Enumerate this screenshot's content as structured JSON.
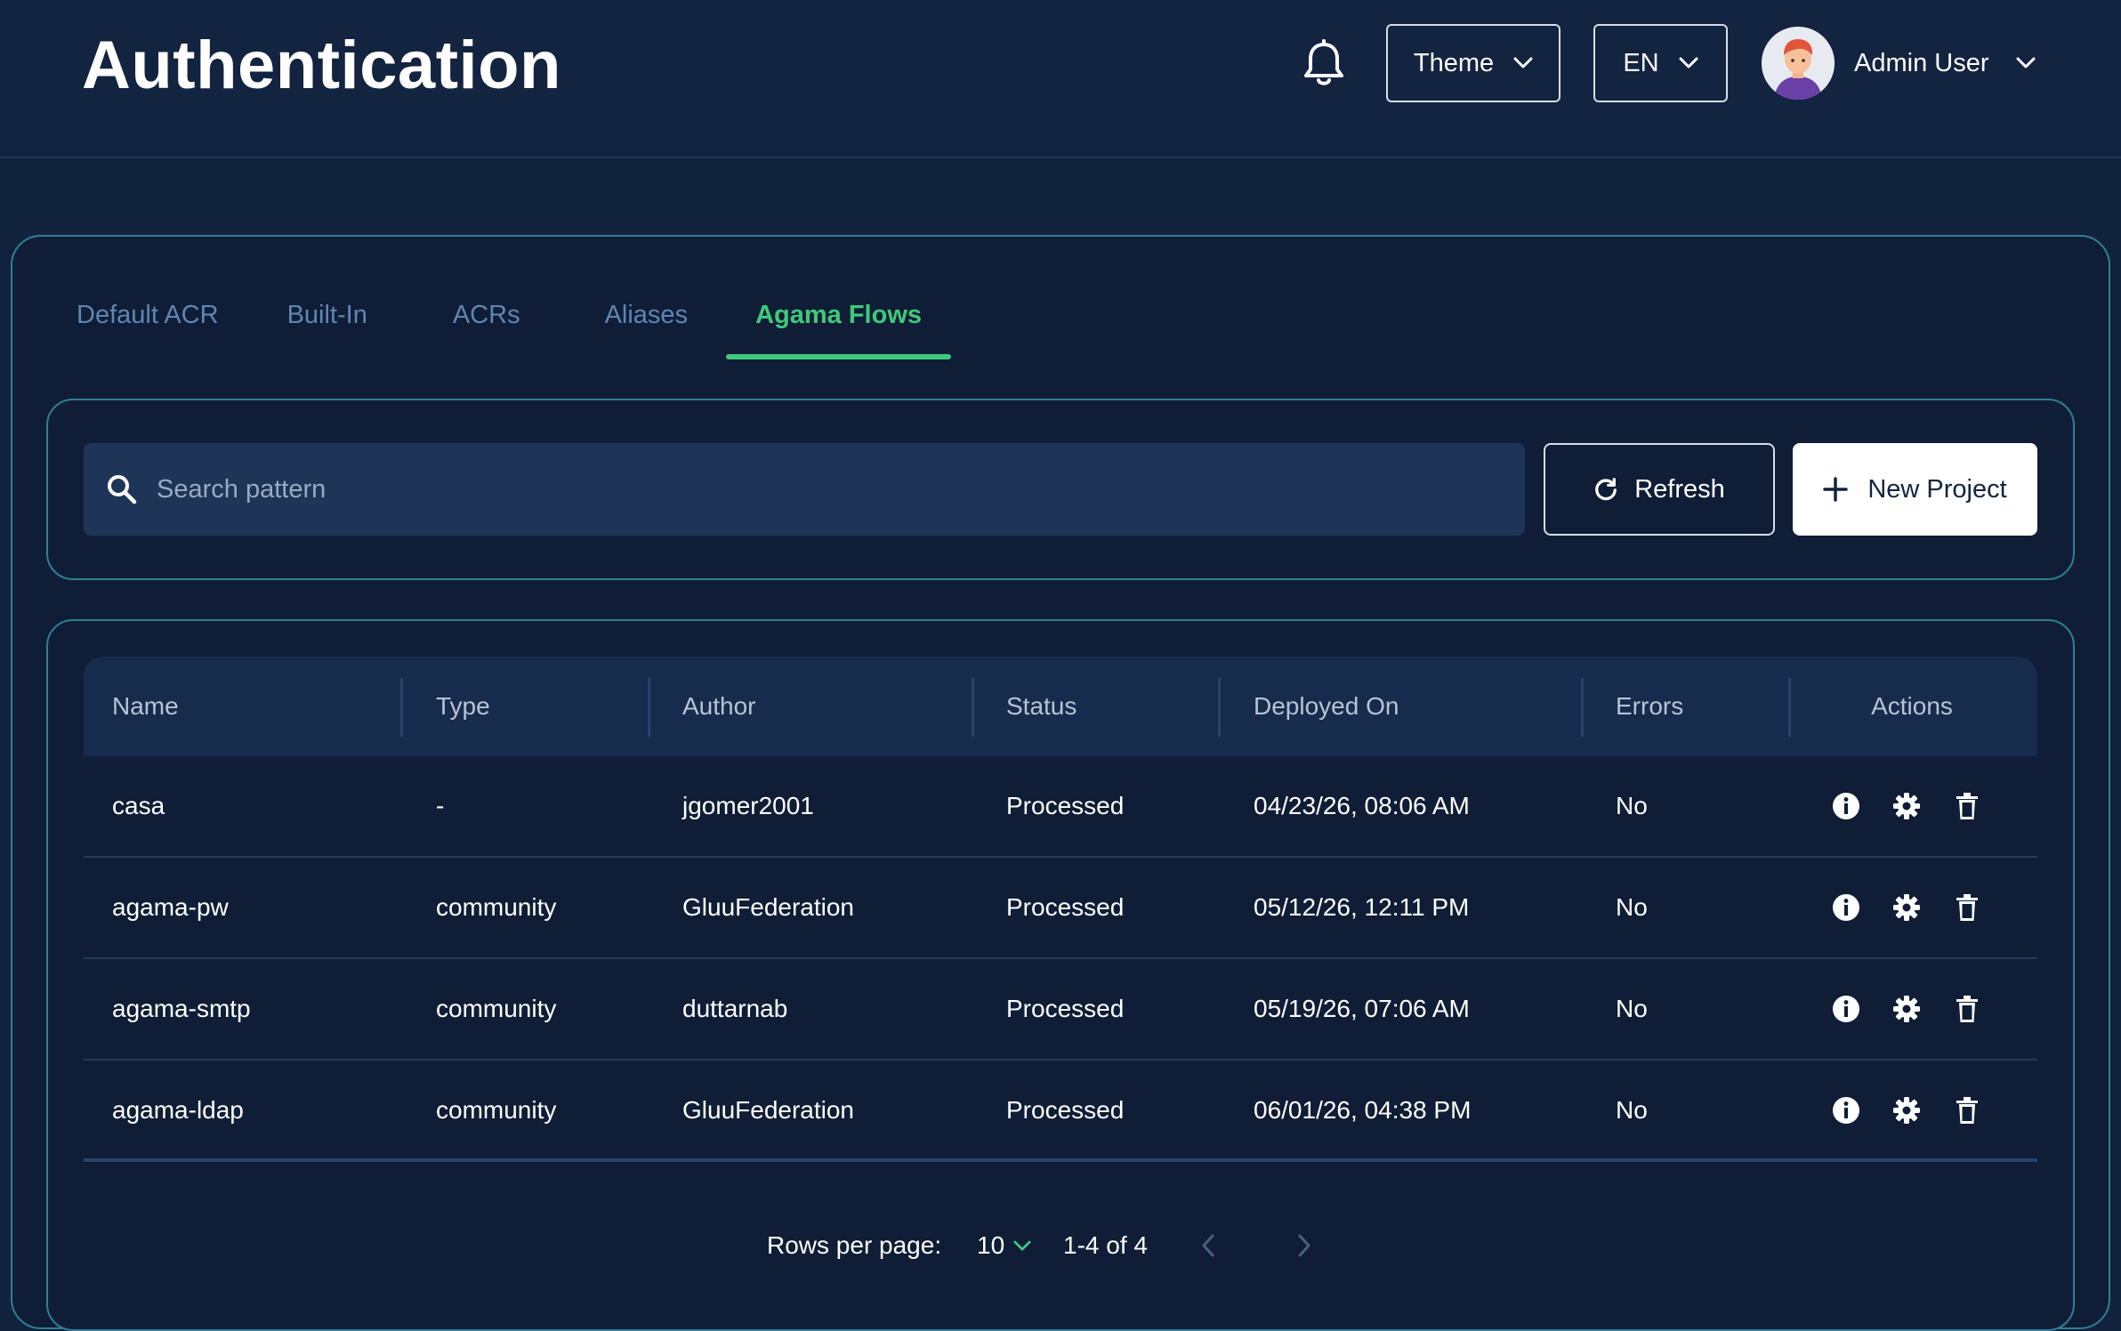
{
  "header": {
    "title": "Authentication",
    "theme_label": "Theme",
    "lang_label": "EN",
    "user_name": "Admin User"
  },
  "tabs": [
    {
      "label": "Default ACR",
      "active": false
    },
    {
      "label": "Built-In",
      "active": false
    },
    {
      "label": "ACRs",
      "active": false
    },
    {
      "label": "Aliases",
      "active": false
    },
    {
      "label": "Agama Flows",
      "active": true
    }
  ],
  "toolbar": {
    "search_placeholder": "Search pattern",
    "search_value": "",
    "refresh_label": "Refresh",
    "new_project_label": "New Project"
  },
  "table": {
    "columns": [
      "Name",
      "Type",
      "Author",
      "Status",
      "Deployed On",
      "Errors",
      "Actions"
    ],
    "rows": [
      {
        "name": "casa",
        "type": "-",
        "author": "jgomer2001",
        "status": "Processed",
        "deployed_on": "04/23/26, 08:06 AM",
        "errors": "No"
      },
      {
        "name": "agama-pw",
        "type": "community",
        "author": "GluuFederation",
        "status": "Processed",
        "deployed_on": "05/12/26, 12:11 PM",
        "errors": "No"
      },
      {
        "name": "agama-smtp",
        "type": "community",
        "author": "duttarnab",
        "status": "Processed",
        "deployed_on": "05/19/26, 07:06 AM",
        "errors": "No"
      },
      {
        "name": "agama-ldap",
        "type": "community",
        "author": "GluuFederation",
        "status": "Processed",
        "deployed_on": "06/01/26, 04:38 PM",
        "errors": "No"
      }
    ],
    "row_actions": [
      "info-icon",
      "gear-icon",
      "trash-icon"
    ]
  },
  "pagination": {
    "rows_per_page_label": "Rows per page:",
    "rows_per_page_value": "10",
    "range_label": "1-4 of 4"
  },
  "colors": {
    "background": "#11223d",
    "accent_green": "#3fc97a",
    "panel_border": "#2f7f96",
    "inactive_tab": "#5f86b3"
  }
}
